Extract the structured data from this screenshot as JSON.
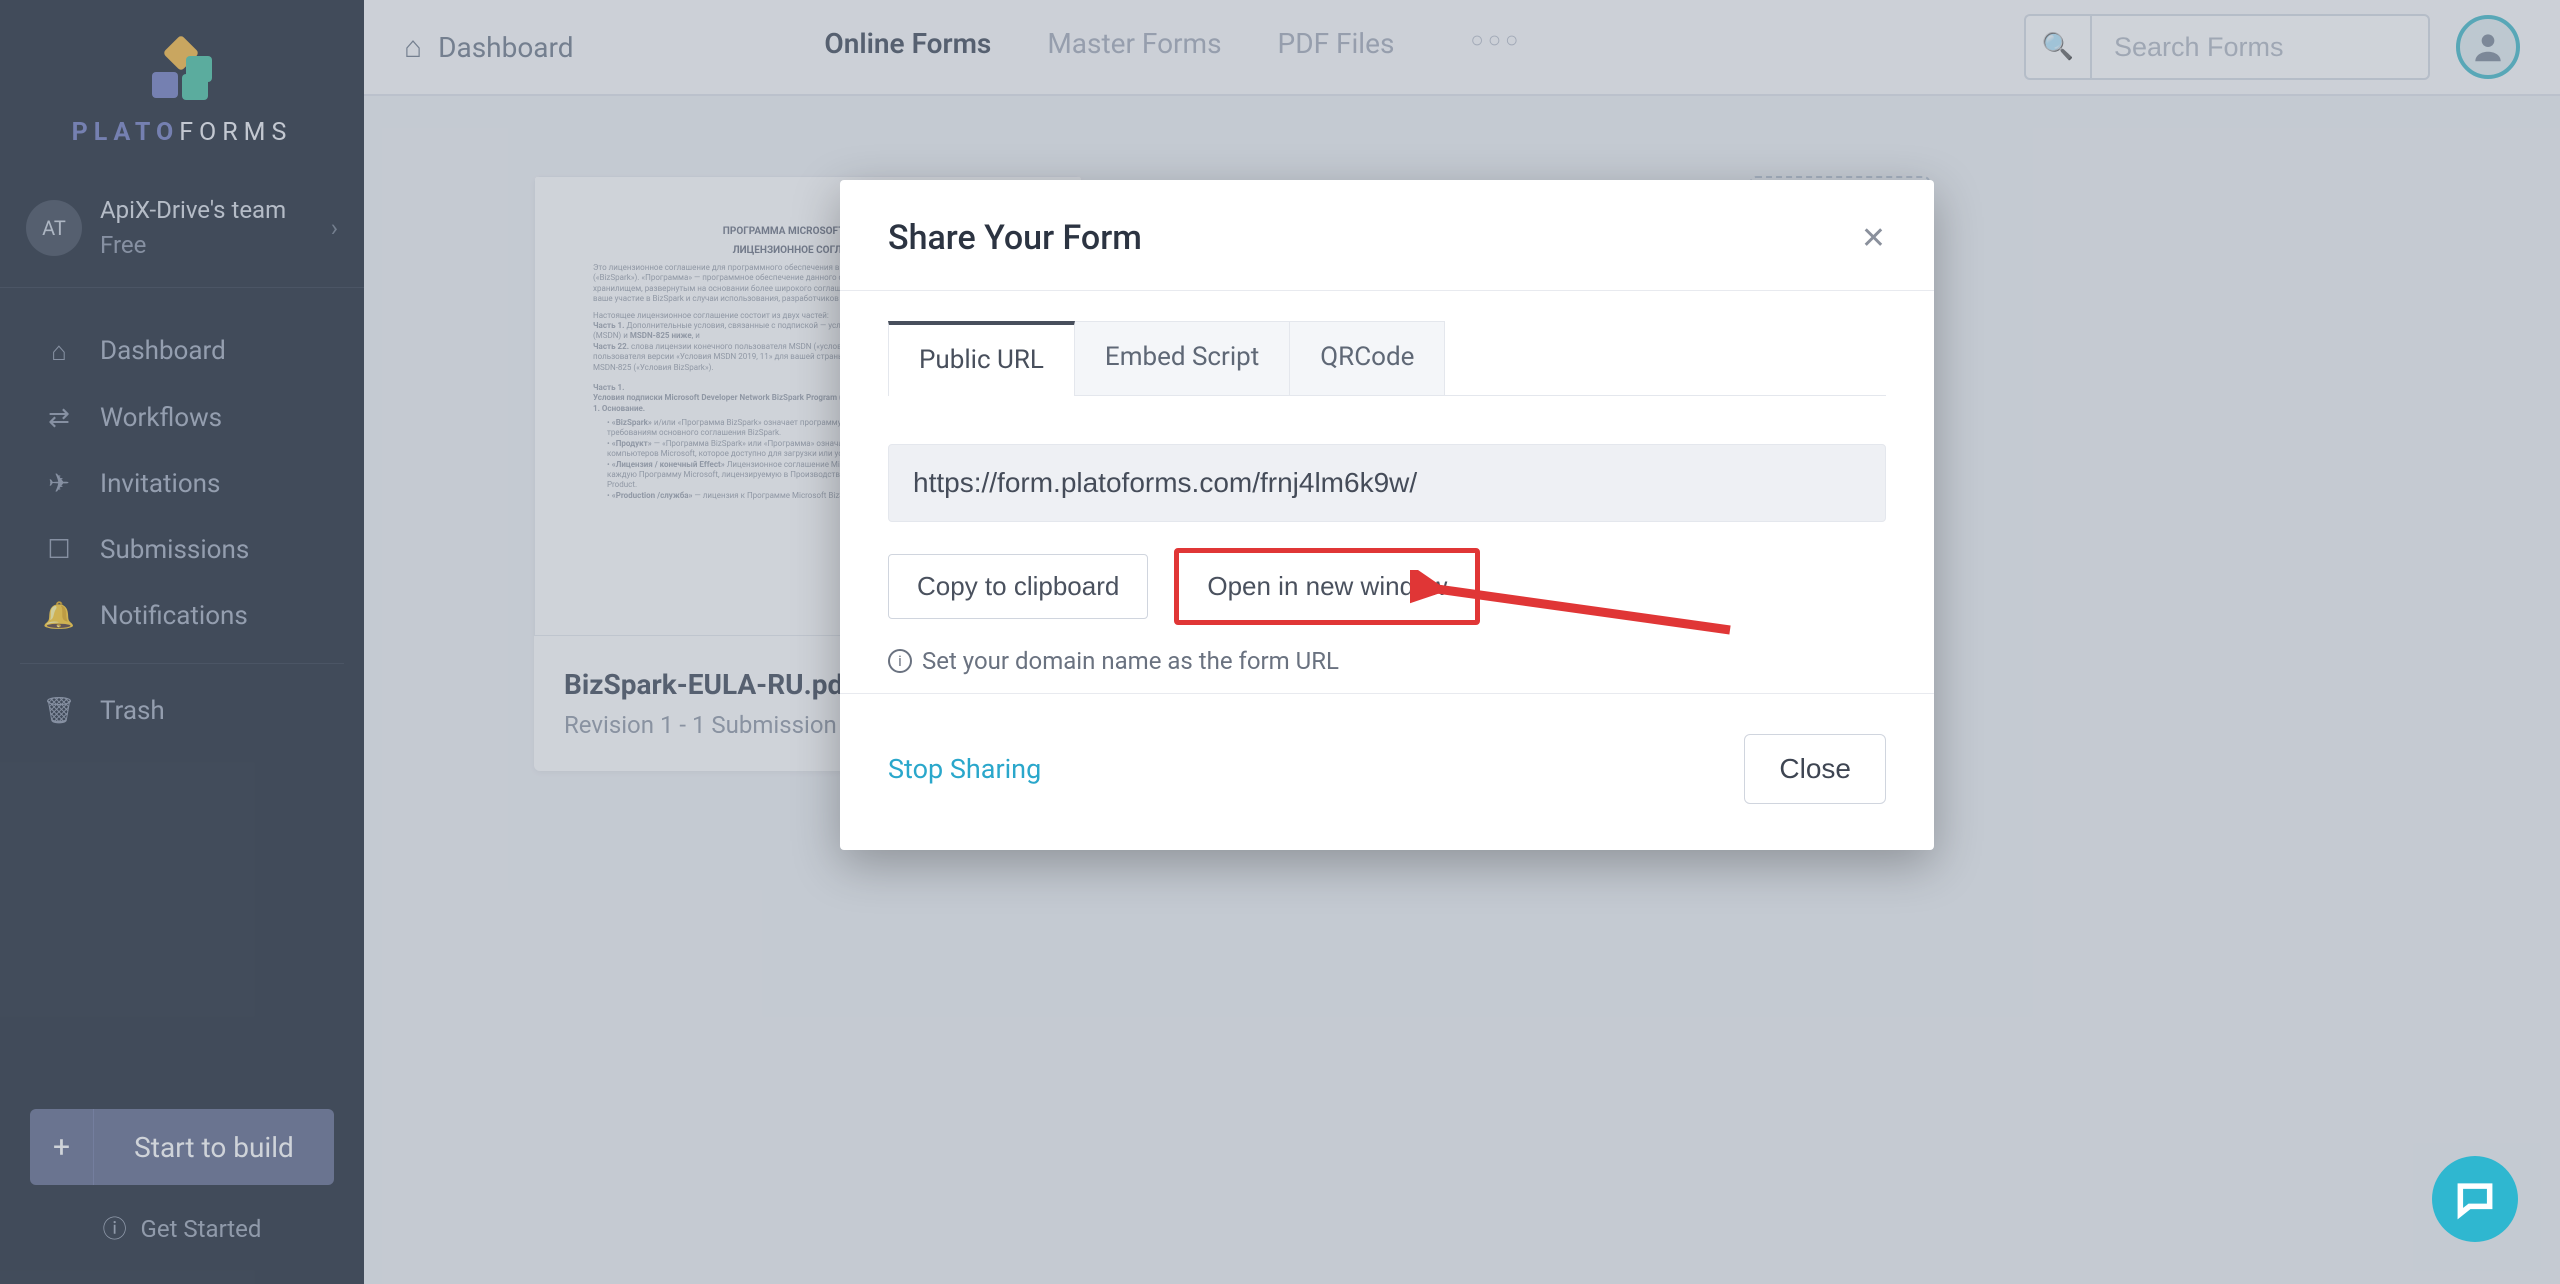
{
  "brand": {
    "name_a": "PLATO",
    "name_b": "FORMS"
  },
  "team": {
    "avatar": "AT",
    "name": "ApiX-Drive's team",
    "plan": "Free"
  },
  "nav": {
    "dashboard": "Dashboard",
    "workflows": "Workflows",
    "invitations": "Invitations",
    "submissions": "Submissions",
    "notifications": "Notifications",
    "trash": "Trash"
  },
  "sidebar_actions": {
    "start_build": "Start to build",
    "get_started": "Get Started"
  },
  "topbar": {
    "breadcrumb": "Dashboard",
    "tabs": {
      "online": "Online Forms",
      "master": "Master Forms",
      "pdf": "PDF Files"
    },
    "search_placeholder": "Search Forms"
  },
  "card": {
    "doc_title1": "ПРОГРАММА MICROSOFT BIZSPARK",
    "doc_title2": "ЛИЦЕНЗИОННОЕ СОГЛАШЕНИЕ",
    "title": "BizSpark-EULA-RU.pdf",
    "subtitle": "Revision 1 - 1 Submission"
  },
  "modal": {
    "title": "Share Your Form",
    "tabs": {
      "public": "Public URL",
      "embed": "Embed Script",
      "qrcode": "QRCode"
    },
    "url": "https://form.platoforms.com/frnj4lm6k9w/",
    "copy": "Copy to clipboard",
    "open": "Open in new window",
    "hint": "Set your domain name as the form URL",
    "stop": "Stop Sharing",
    "close": "Close"
  }
}
